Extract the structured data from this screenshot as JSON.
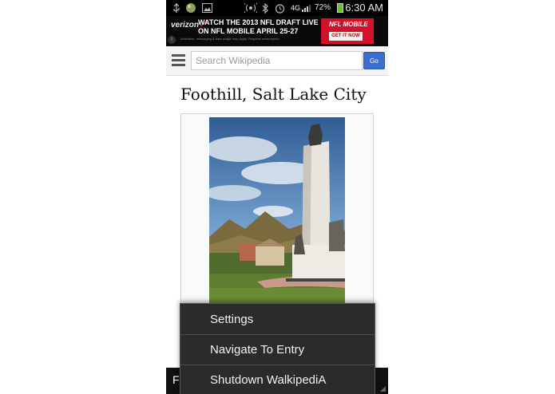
{
  "status_bar": {
    "time": "6:30 AM",
    "battery_percent": "72%",
    "network": "4G",
    "icons": [
      "usb-icon",
      "globe-icon",
      "gallery-icon",
      "wifi-calling-icon",
      "bluetooth-icon",
      "alarm-icon",
      "network-4g-icon",
      "signal-icon",
      "battery-icon"
    ]
  },
  "ad": {
    "brand": "verizon",
    "line1": "WATCH THE 2013 NFL DRAFT LIVE",
    "line2": "ON NFL MOBILE APRIL 25-27",
    "fine_print": "Activation, messaging & data usage may apply. Requires subscription.",
    "box_title": "NFL MOBILE",
    "cta": "GET IT NOW",
    "brand_color": "#d2122a"
  },
  "search": {
    "placeholder": "Search Wikipedia",
    "value": "",
    "go_label": "Go",
    "go_color": "#3a6fd1"
  },
  "article": {
    "title": "Foothill, Salt Lake City"
  },
  "bottom_bar": {
    "text": "F"
  },
  "menu": {
    "items": [
      {
        "label": "Settings"
      },
      {
        "label": "Navigate To Entry"
      },
      {
        "label": "Shutdown WalkipediA"
      }
    ]
  }
}
